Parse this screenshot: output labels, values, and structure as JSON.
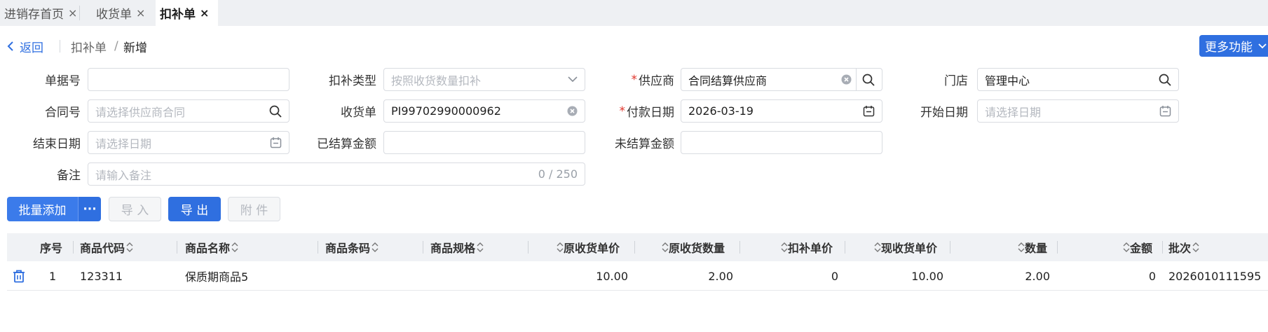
{
  "tabs": [
    {
      "label": "进销存首页",
      "close": "×"
    },
    {
      "label": "收货单",
      "close": "×"
    },
    {
      "label": "扣补单",
      "close": "×"
    }
  ],
  "breadcrumb": {
    "back": "返回",
    "parent": "扣补单",
    "separator": "/",
    "current": "新增"
  },
  "more_button": "更多功能",
  "form": {
    "doc_no": {
      "label": "单据号",
      "value": ""
    },
    "deduct_type": {
      "label": "扣补类型",
      "placeholder": "按照收货数量扣补"
    },
    "supplier": {
      "label": "供应商",
      "value": "合同结算供应商"
    },
    "store": {
      "label": "门店",
      "value": "管理中心"
    },
    "contract_no": {
      "label": "合同号",
      "placeholder": "请选择供应商合同"
    },
    "receipt": {
      "label": "收货单",
      "value": "PI99702990000962"
    },
    "pay_date": {
      "label": "付款日期",
      "value": "2026-03-19"
    },
    "start_date": {
      "label": "开始日期",
      "placeholder": "请选择日期"
    },
    "end_date": {
      "label": "结束日期",
      "placeholder": "请选择日期"
    },
    "settled_amount": {
      "label": "已结算金额",
      "value": ""
    },
    "unsettled_amount": {
      "label": "未结算金额",
      "value": ""
    },
    "remark": {
      "label": "备注",
      "placeholder": "请输入备注",
      "counter": "0 / 250"
    }
  },
  "toolbar": {
    "batch_add": "批量添加",
    "more": "···",
    "import": "导 入",
    "export": "导 出",
    "attachment": "附 件"
  },
  "table": {
    "headers": {
      "seq": "序号",
      "code": "商品代码",
      "name": "商品名称",
      "barcode": "商品条码",
      "spec": "商品规格",
      "orig_price": "原收货单价",
      "orig_qty": "原收货数量",
      "deduct_price": "扣补单价",
      "cur_price": "现收货单价",
      "qty": "数量",
      "amount": "金额",
      "batch": "批次"
    },
    "rows": [
      {
        "seq": "1",
        "code": "123311",
        "name": "保质期商品5",
        "barcode": "",
        "spec": "",
        "orig_price": "10.00",
        "orig_qty": "2.00",
        "deduct_price": "0",
        "cur_price": "10.00",
        "qty": "2.00",
        "amount": "0",
        "batch": "2026010111595"
      }
    ]
  },
  "colors": {
    "primary": "#2f6fe0",
    "required": "#e0352b",
    "header_bg": "#f0f2f5"
  }
}
